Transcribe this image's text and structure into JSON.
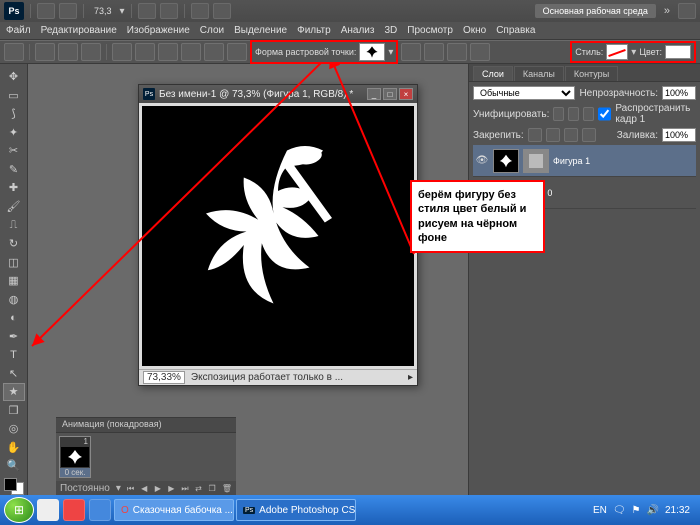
{
  "app_logo": "Ps",
  "top_zoom": "73,3",
  "workspace": "Основная рабочая среда",
  "menu": {
    "file": "Файл",
    "edit": "Редактирование",
    "image": "Изображение",
    "layer": "Слои",
    "select": "Выделение",
    "filter": "Фильтр",
    "analysis": "Анализ",
    "3d": "3D",
    "view": "Просмотр",
    "window": "Окно",
    "help": "Справка"
  },
  "options": {
    "shape_label": "Форма растровой точки:",
    "style_label": "Стиль:",
    "color_label": "Цвет:"
  },
  "doc": {
    "title": "Без имени-1 @ 73,3% (Фигура 1, RGB/8) *",
    "zoom": "73,33%",
    "status": "Экспозиция работает только в ..."
  },
  "panels": {
    "tab_layers": "Слои",
    "tab_channels": "Каналы",
    "tab_paths": "Контуры",
    "mode": "Обычные",
    "opacity_label": "Непрозрачность:",
    "opacity_val": "100%",
    "unify_label": "Унифицировать:",
    "propagate": "Распространить кадр 1",
    "lock_label": "Закрепить:",
    "fill_label": "Заливка:",
    "fill_val": "100%",
    "layer1": "Фигура 1",
    "layer0": "Слой 0"
  },
  "annotation": "берём фигуру без стиля цвет белый и рисуем на чёрном фоне",
  "animation": {
    "title": "Анимация (покадровая)",
    "frame_time": "0 сек.",
    "loop": "Постоянно"
  },
  "taskbar": {
    "t1": "Сказочная бабочка ...",
    "t2": "Adobe Photoshop CS...",
    "lang": "EN",
    "time": "21:32"
  }
}
